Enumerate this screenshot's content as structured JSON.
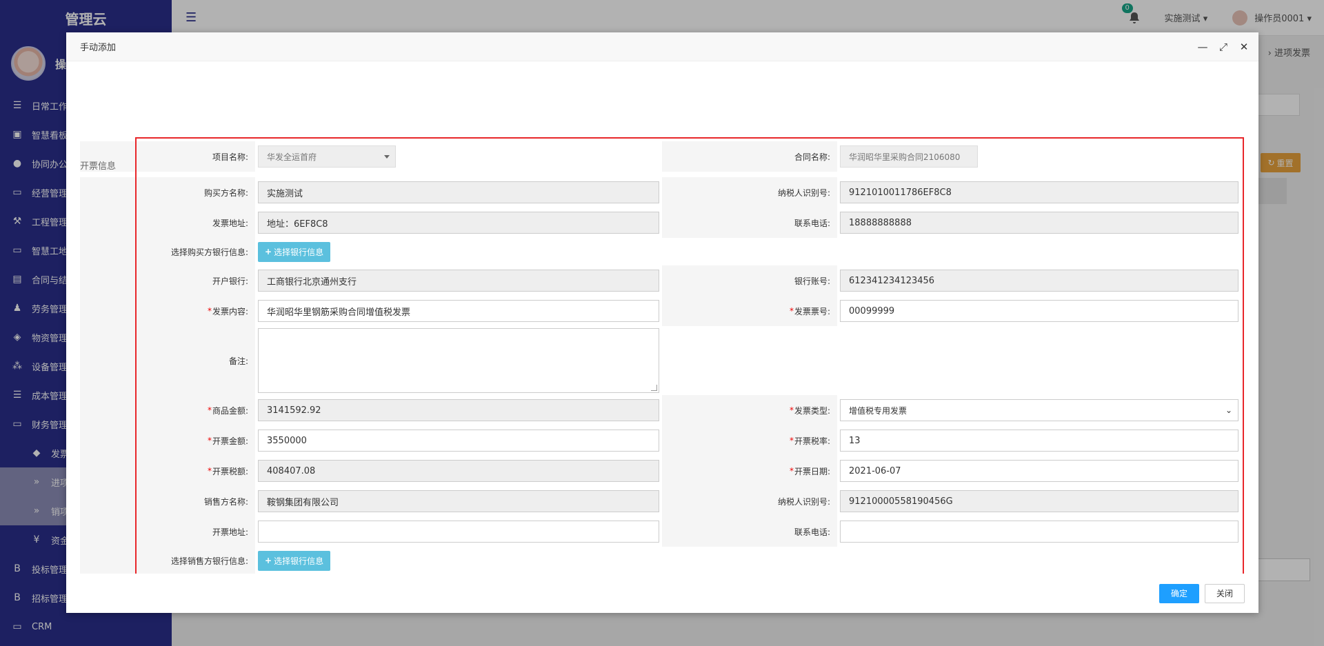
{
  "app": {
    "brand": "管理云",
    "user_initial": "操",
    "menu": [
      {
        "icon": "list-icon",
        "label": "日常工作"
      },
      {
        "icon": "dashboard-icon",
        "label": "智慧看板"
      },
      {
        "icon": "users-icon",
        "label": "协同办公"
      },
      {
        "icon": "monitor-icon",
        "label": "经营管理"
      },
      {
        "icon": "hammer-icon",
        "label": "工程管理"
      },
      {
        "icon": "monitor-icon",
        "label": "智慧工地"
      },
      {
        "icon": "file-icon",
        "label": "合同与结算"
      },
      {
        "icon": "worker-icon",
        "label": "劳务管理"
      },
      {
        "icon": "cube-icon",
        "label": "物资管理"
      },
      {
        "icon": "cubes-icon",
        "label": "设备管理"
      },
      {
        "icon": "list-icon",
        "label": "成本管理"
      },
      {
        "icon": "monitor-icon",
        "label": "财务管理"
      }
    ],
    "sub_menu": [
      {
        "icon": "tags-icon",
        "label": "发票"
      },
      {
        "icon": "chevron-right-icon",
        "label": "进项"
      },
      {
        "icon": "chevron-right-icon",
        "label": "销项"
      },
      {
        "icon": "yen-icon",
        "label": "资金"
      }
    ],
    "menu_after": [
      {
        "icon": "b-icon",
        "label": "投标管理"
      },
      {
        "icon": "b-icon",
        "label": "招标管理"
      },
      {
        "icon": "monitor-icon",
        "label": "CRM"
      }
    ],
    "notifications": "0",
    "project_selector": "实施测试",
    "username": "操作员0001",
    "breadcrumb_current": "进项发票",
    "reset_label": "重置"
  },
  "modal": {
    "title": "手动添加",
    "section_title": "开票信息",
    "ok_label": "确定",
    "close_label": "关闭",
    "fields": {
      "project_name": {
        "label": "项目名称:",
        "value": "华发全运首府"
      },
      "contract_name": {
        "label": "合同名称:",
        "value": "华润昭华里采购合同2106080"
      },
      "buyer_name": {
        "label": "购买方名称:",
        "value": "实施测试"
      },
      "buyer_taxid": {
        "label": "纳税人识别号:",
        "value": "9121010011786EF8C8"
      },
      "invoice_address": {
        "label": "发票地址:",
        "value": "地址：6EF8C8"
      },
      "buyer_phone": {
        "label": "联系电话:",
        "value": "18888888888"
      },
      "buyer_bank_select": {
        "label": "选择购买方银行信息:",
        "button": "选择银行信息"
      },
      "bank_name": {
        "label": "开户银行:",
        "value": "工商银行北京通州支行"
      },
      "bank_account": {
        "label": "银行账号:",
        "value": "612341234123456"
      },
      "invoice_content": {
        "label": "发票内容:",
        "value": "华润昭华里钢筋采购合同增值税发票"
      },
      "invoice_number": {
        "label": "发票票号:",
        "value": "00099999"
      },
      "remark": {
        "label": "备注:",
        "value": ""
      },
      "goods_amount": {
        "label": "商品金额:",
        "value": "3141592.92"
      },
      "invoice_type": {
        "label": "发票类型:",
        "value": "增值税专用发票"
      },
      "invoice_amount": {
        "label": "开票金额:",
        "value": "3550000"
      },
      "tax_rate": {
        "label": "开票税率:",
        "value": "13"
      },
      "tax_amount": {
        "label": "开票税额:",
        "value": "408407.08"
      },
      "invoice_date": {
        "label": "开票日期:",
        "value": "2021-06-07"
      },
      "seller_name": {
        "label": "销售方名称:",
        "value": "鞍钢集团有限公司"
      },
      "seller_taxid": {
        "label": "纳税人识别号:",
        "value": "91210000558190456G"
      },
      "seller_address": {
        "label": "开票地址:",
        "value": ""
      },
      "seller_phone": {
        "label": "联系电话:",
        "value": ""
      },
      "seller_bank_select": {
        "label": "选择销售方银行信息:",
        "button": "选择银行信息"
      }
    }
  },
  "colors": {
    "sidebar": "#2a2f8c",
    "primary": "#1e9fff",
    "info": "#5bc0de",
    "highlight_frame": "#e8262a",
    "warning": "#e8a33d"
  }
}
